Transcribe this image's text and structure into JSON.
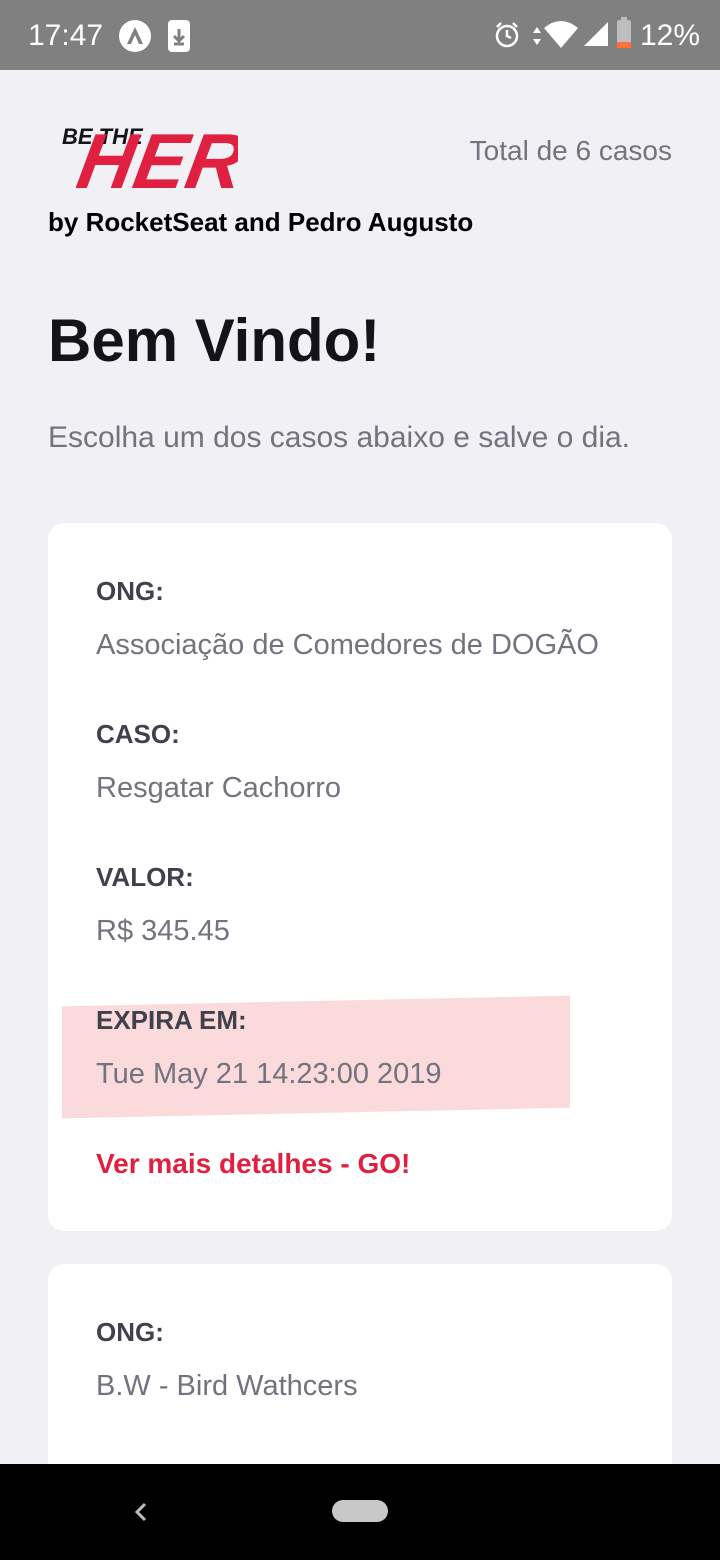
{
  "status_bar": {
    "time": "17:47",
    "battery": "12%",
    "icons": [
      "app-notification-icon",
      "download-notification-icon",
      "alarm-icon",
      "data-transfer-icon",
      "wifi-icon",
      "cell-signal-icon",
      "battery-icon"
    ]
  },
  "header": {
    "logo_text_small": "BE THE",
    "logo_text_big": "HERO",
    "byline": "by RocketSeat and Pedro Augusto",
    "total": "Total de 6 casos"
  },
  "main": {
    "title": "Bem Vindo!",
    "description": "Escolha um dos casos abaixo e salve o dia."
  },
  "incidents": [
    {
      "ong_label": "ONG:",
      "ong": "Associação de Comedores de DOGÃO",
      "case_label": "CASO:",
      "case": "Resgatar Cachorro",
      "value_label": "VALOR:",
      "value": "R$ 345.45",
      "expires_label": "EXPIRA EM:",
      "expires": "Tue May 21 14:23:00 2019",
      "details_link": "Ver mais detalhes - GO!"
    },
    {
      "ong_label": "ONG:",
      "ong": "B.W - Bird Wathcers"
    }
  ],
  "colors": {
    "background": "#f0f0f5",
    "accent": "#e02041",
    "status_bar": "#808080",
    "highlight": "#f4c6c6"
  }
}
